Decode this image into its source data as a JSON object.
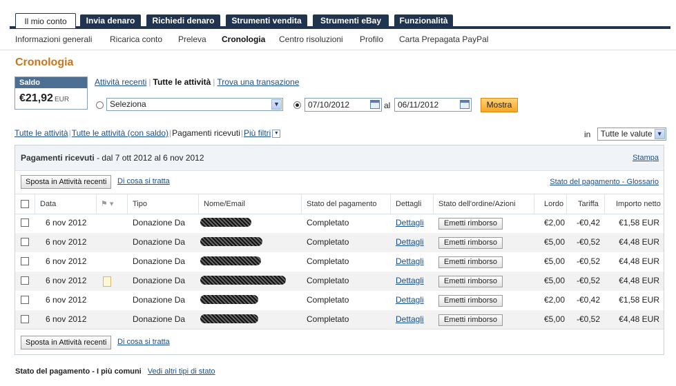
{
  "tabs": [
    "Il mio conto",
    "Invia denaro",
    "Richiedi denaro",
    "Strumenti vendita",
    "Strumenti eBay",
    "Funzionalità"
  ],
  "subnav": [
    "Informazioni generali",
    "Ricarica conto",
    "Preleva",
    "Cronologia",
    "Centro risoluzioni",
    "Profilo",
    "Carta Prepagata PayPal"
  ],
  "page_title": "Cronologia",
  "balance": {
    "label": "Saldo",
    "amount": "€21,92",
    "currency": "EUR"
  },
  "views": {
    "recent": "Attività recenti",
    "all": "Tutte le attività",
    "find": "Trova una transazione"
  },
  "filter": {
    "select_value": "Seleziona",
    "date_from": "07/10/2012",
    "to_label": "al",
    "date_to": "06/11/2012",
    "show_button": "Mostra"
  },
  "filter_links": {
    "all": "Tutte le attività",
    "all_balance": "Tutte le attività (con saldo)",
    "received": "Pagamenti ricevuti",
    "more": "Più filtri"
  },
  "currency": {
    "label": "in",
    "value": "Tutte le valute"
  },
  "panel": {
    "title": "Pagamenti ricevuti",
    "range": "- dal 7 ott 2012 al 6 nov 2012",
    "print": "Stampa",
    "move_button": "Sposta in Attività recenti",
    "what_link": "Di cosa si tratta",
    "glossary_link": "Stato del pagamento - Glossario"
  },
  "columns": [
    "Data",
    "Tipo",
    "Nome/Email",
    "Stato del pagamento",
    "Dettagli",
    "Stato dell'ordine/Azioni",
    "Lordo",
    "Tariffa",
    "Importo netto"
  ],
  "rows": [
    {
      "date": "6 nov 2012",
      "type": "Donazione Da",
      "status": "Completato",
      "details": "Dettagli",
      "action": "Emetti rimborso",
      "gross": "€2,00",
      "fee": "-€0,42",
      "net": "€1,58 EUR",
      "note": false
    },
    {
      "date": "6 nov 2012",
      "type": "Donazione Da",
      "status": "Completato",
      "details": "Dettagli",
      "action": "Emetti rimborso",
      "gross": "€5,00",
      "fee": "-€0,52",
      "net": "€4,48 EUR",
      "note": false
    },
    {
      "date": "6 nov 2012",
      "type": "Donazione Da",
      "status": "Completato",
      "details": "Dettagli",
      "action": "Emetti rimborso",
      "gross": "€5,00",
      "fee": "-€0,52",
      "net": "€4,48 EUR",
      "note": false
    },
    {
      "date": "6 nov 2012",
      "type": "Donazione Da",
      "status": "Completato",
      "details": "Dettagli",
      "action": "Emetti rimborso",
      "gross": "€5,00",
      "fee": "-€0,52",
      "net": "€4,48 EUR",
      "note": true
    },
    {
      "date": "6 nov 2012",
      "type": "Donazione Da",
      "status": "Completato",
      "details": "Dettagli",
      "action": "Emetti rimborso",
      "gross": "€2,00",
      "fee": "-€0,42",
      "net": "€1,58 EUR",
      "note": false
    },
    {
      "date": "6 nov 2012",
      "type": "Donazione Da",
      "status": "Completato",
      "details": "Dettagli",
      "action": "Emetti rimborso",
      "gross": "€5,00",
      "fee": "-€0,52",
      "net": "€4,48 EUR",
      "note": false
    }
  ],
  "footer": {
    "status_title": "Stato del pagamento - I più comuni",
    "status_link": "Vedi altri tipi di stato"
  }
}
